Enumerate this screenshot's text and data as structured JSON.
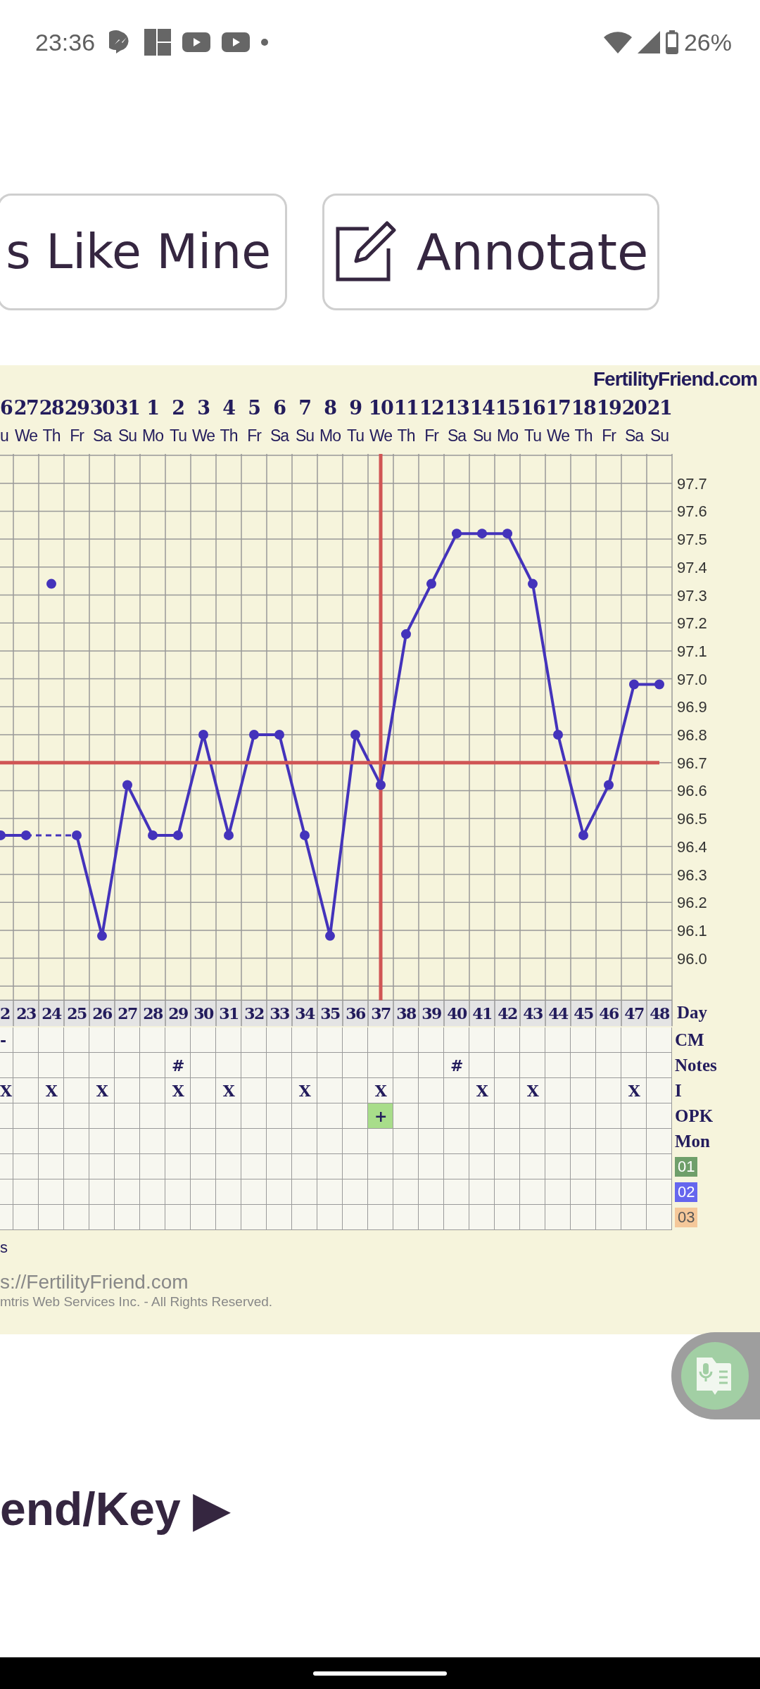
{
  "status_bar": {
    "time": "23:36",
    "battery": "26%"
  },
  "buttons": [
    {
      "label": "s Like Mine",
      "kind": "text"
    },
    {
      "label": "Annotate",
      "kind": "pencil"
    }
  ],
  "chart": {
    "brand": "FertilityFriend.com",
    "dates": [
      "6",
      "27",
      "28",
      "29",
      "30",
      "31",
      "1",
      "2",
      "3",
      "4",
      "5",
      "6",
      "7",
      "8",
      "9",
      "10",
      "11",
      "12",
      "13",
      "14",
      "15",
      "16",
      "17",
      "18",
      "19",
      "20",
      "21"
    ],
    "weekdays": [
      "u",
      "We",
      "Th",
      "Fr",
      "Sa",
      "Su",
      "Mo",
      "Tu",
      "We",
      "Th",
      "Fr",
      "Sa",
      "Su",
      "Mo",
      "Tu",
      "We",
      "Th",
      "Fr",
      "Sa",
      "Su",
      "Mo",
      "Tu",
      "We",
      "Th",
      "Fr",
      "Sa",
      "Su"
    ],
    "chart_data": {
      "type": "line",
      "grid": true,
      "categories": [
        "2",
        "23",
        "24",
        "25",
        "26",
        "27",
        "28",
        "29",
        "30",
        "31",
        "32",
        "33",
        "34",
        "35",
        "36",
        "37",
        "38",
        "39",
        "40",
        "41",
        "42",
        "43",
        "44",
        "45",
        "46",
        "47",
        "48"
      ],
      "ylim": [
        95.85,
        97.8
      ],
      "yticks": [
        {
          "value": 96.0,
          "label": "96.0"
        },
        {
          "value": 96.1,
          "label": "96.1"
        },
        {
          "value": 96.2,
          "label": "96.2"
        },
        {
          "value": 96.3,
          "label": "96.3"
        },
        {
          "value": 96.4,
          "label": "96.4"
        },
        {
          "value": 96.5,
          "label": "96.5"
        },
        {
          "value": 96.6,
          "label": "96.6"
        },
        {
          "value": 96.7,
          "label": "96.7"
        },
        {
          "value": 96.8,
          "label": "96.8"
        },
        {
          "value": 96.9,
          "label": "96.9"
        },
        {
          "value": 97.0,
          "label": "97.0"
        },
        {
          "value": 97.1,
          "label": "97.1"
        },
        {
          "value": 97.2,
          "label": "97.2"
        },
        {
          "value": 97.3,
          "label": "97.3"
        },
        {
          "value": 97.4,
          "label": "97.4"
        },
        {
          "value": 97.5,
          "label": "97.5"
        },
        {
          "value": 97.6,
          "label": "97.6"
        },
        {
          "value": 97.7,
          "label": "97.7"
        }
      ],
      "series": [
        {
          "color": "#4433bb",
          "marker": "circle",
          "values": [
            96.44,
            96.44,
            null,
            96.44,
            96.08,
            96.62,
            96.44,
            96.44,
            96.8,
            96.44,
            96.8,
            96.8,
            96.44,
            96.08,
            96.8,
            96.62,
            97.16,
            97.34,
            97.52,
            97.52,
            97.52,
            97.34,
            96.8,
            96.44,
            96.62,
            96.98,
            96.98
          ]
        },
        {
          "color": "#4433bb",
          "marker": "circle",
          "values": [
            null,
            null,
            97.34,
            null,
            null,
            null,
            null,
            null,
            null,
            null,
            null,
            null,
            null,
            null,
            null,
            null,
            null,
            null,
            null,
            null,
            null,
            null,
            null,
            null,
            null,
            null,
            null
          ]
        },
        {
          "color": "#d05555",
          "marker": "none",
          "values": [
            96.7,
            96.7,
            96.7,
            96.7,
            96.7,
            96.7,
            96.7,
            96.7,
            96.7,
            96.7,
            96.7,
            96.7,
            96.7,
            96.7,
            96.7,
            96.7,
            96.7,
            96.7,
            96.7,
            96.7,
            96.7,
            96.7,
            96.7,
            96.7,
            96.7,
            96.7,
            96.7
          ]
        }
      ],
      "ref_lines": [
        {
          "axis": "x",
          "value": "37",
          "color": "#d05555"
        }
      ]
    },
    "row_header": "Day",
    "rows": [
      {
        "label": "CM",
        "cells": [
          "-",
          null,
          null,
          null,
          null,
          null,
          null,
          null,
          null,
          null,
          null,
          null,
          null,
          null,
          null,
          null,
          null,
          null,
          null,
          null,
          null,
          null,
          null,
          null,
          null,
          null,
          null
        ]
      },
      {
        "label": "Notes",
        "cells": [
          null,
          null,
          null,
          null,
          null,
          null,
          null,
          "#",
          null,
          null,
          null,
          null,
          null,
          null,
          null,
          null,
          null,
          null,
          "#",
          null,
          null,
          null,
          null,
          null,
          null,
          null,
          null
        ]
      },
      {
        "label": "I",
        "cells": [
          "X",
          null,
          "X",
          null,
          "X",
          null,
          null,
          "X",
          null,
          "X",
          null,
          null,
          "X",
          null,
          null,
          "X",
          null,
          null,
          null,
          "X",
          null,
          "X",
          null,
          null,
          null,
          "X",
          null
        ]
      },
      {
        "label": "OPK",
        "cells": [
          null,
          null,
          null,
          null,
          null,
          null,
          null,
          null,
          null,
          null,
          null,
          null,
          null,
          null,
          null,
          {
            "text": "+",
            "color": "#a8dd8a"
          },
          null,
          null,
          null,
          null,
          null,
          null,
          null,
          null,
          null,
          null,
          null
        ]
      },
      {
        "label": "Mon",
        "cells": []
      },
      {
        "label": "01",
        "color": "#6f9f6a",
        "cells": []
      },
      {
        "label": "02",
        "color": "#6666ee",
        "cells": []
      },
      {
        "label": "03",
        "color": "#f5c89a",
        "cells": []
      }
    ]
  },
  "footer": [
    "s",
    "s://FertilityFriend.com",
    "mtris Web Services Inc. - All Rights Reserved."
  ],
  "legend_heading": "end/Key ▶"
}
